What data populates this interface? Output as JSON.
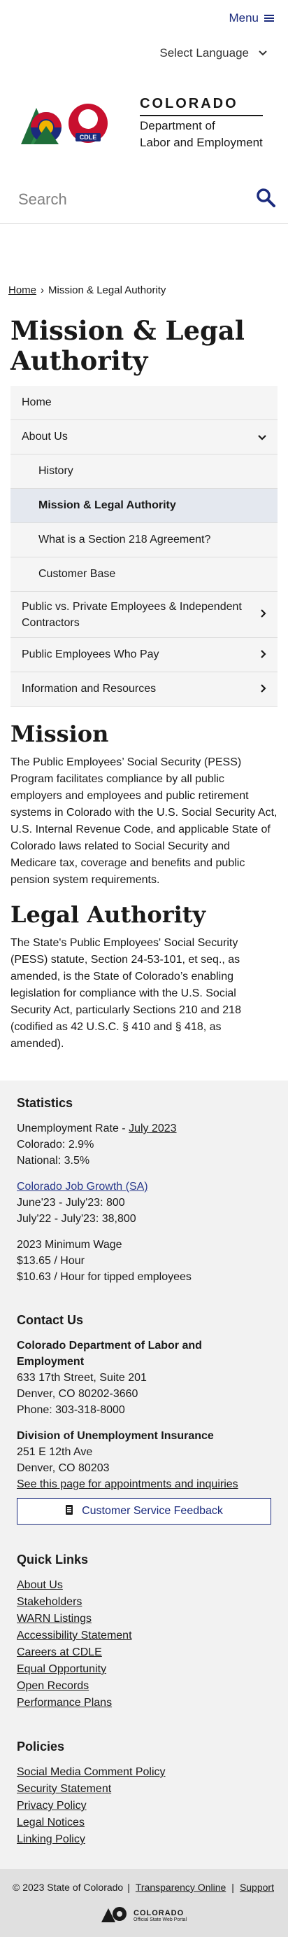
{
  "header": {
    "menu_label": "Menu",
    "language_label": "Select Language",
    "logo": {
      "state": "COLORADO",
      "dept_line1": "Department of",
      "dept_line2": "Labor and Employment",
      "badge": "CDLE"
    },
    "search_placeholder": "Search"
  },
  "breadcrumb": {
    "home": "Home",
    "separator": "›",
    "current": "Mission & Legal Authority"
  },
  "page_title": "Mission & Legal Authority",
  "sidenav": {
    "items": [
      {
        "label": "Home"
      },
      {
        "label": "About Us"
      },
      {
        "label": "History"
      },
      {
        "label": "Mission & Legal Authority"
      },
      {
        "label": "What is a Section 218 Agreement?"
      },
      {
        "label": "Customer Base"
      },
      {
        "label": "Public vs. Private Employees & Independent Contractors"
      },
      {
        "label": "Public Employees Who Pay"
      },
      {
        "label": "Information and Resources"
      }
    ]
  },
  "mission": {
    "heading": "Mission",
    "text": "The Public Employees’ Social Security (PESS) Program facilitates compliance by all public employers and employees and public retirement systems in Colorado with the U.S. Social Security Act, U.S. Internal Revenue Code, and applicable State of Colorado laws related to Social Security and Medicare tax, coverage and benefits and public pension system requirements."
  },
  "legal": {
    "heading": "Legal Authority",
    "text": "The State's Public Employees' Social Security (PESS) statute, Section 24-53-101, et seq., as amended, is the State of Colorado’s enabling legislation for compliance with the U.S. Social Security Act, particularly Sections 210 and 218 (codified as 42 U.S.C. § 410 and § 418, as amended)."
  },
  "footer": {
    "statistics": {
      "heading": "Statistics",
      "unemp_prefix": "Unemployment Rate - ",
      "unemp_link": "July 2023",
      "colorado": "Colorado: 2.9%",
      "national": "National: 3.5%",
      "job_growth_link": "Colorado Job Growth (SA)",
      "june_july": "June'23 - July'23: 800",
      "july_july": "July'22 - July'23: 38,800",
      "wage_heading": "2023 Minimum Wage",
      "wage_hour": "$13.65 / Hour",
      "wage_tipped": "$10.63 / Hour for tipped employees"
    },
    "contact": {
      "heading": "Contact Us",
      "org1_name": "Colorado Department of Labor and Employment",
      "org1_addr1": "633 17th Street, Suite 201",
      "org1_addr2": "Denver, CO  80202-3660",
      "org1_phone": "Phone: 303-318-8000",
      "org2_name": "Division of Unemployment Insurance",
      "org2_addr1": "251 E 12th Ave",
      "org2_addr2": "Denver, CO  80203",
      "org2_link": "See this page for appointments and inquiries",
      "feedback_button": "Customer Service Feedback"
    },
    "quick_links": {
      "heading": "Quick Links",
      "items": [
        "About Us",
        "Stakeholders",
        "WARN Listings",
        "Accessibility Statement",
        "Careers at CDLE",
        "Equal Opportunity",
        "Open Records",
        "Performance Plans"
      ]
    },
    "policies": {
      "heading": "Policies",
      "items": [
        "Social Media Comment Policy",
        "Security Statement",
        "Privacy Policy",
        "Legal Notices",
        "Linking Policy"
      ]
    },
    "bottom": {
      "copyright": "© 2023 State of Colorado",
      "transparency": "Transparency Online",
      "support": "Support",
      "portal_name": "COLORADO",
      "portal_sub": "Official State Web Portal"
    }
  },
  "colors": {
    "brand_blue": "#1b2b7d",
    "active_nav": "#e4e8ef",
    "link_blue": "#2a3a8c"
  }
}
